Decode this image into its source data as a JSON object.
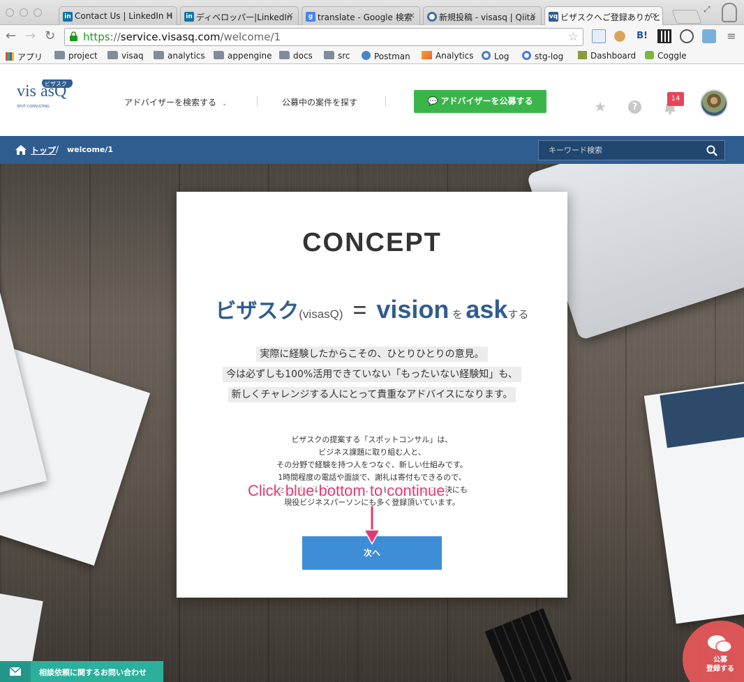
{
  "browser": {
    "tabs": [
      {
        "title": "Contact Us | LinkedIn H",
        "favicon": "linkedin-icon"
      },
      {
        "title": "ディベロッパー|LinkedIn",
        "favicon": "linkedin-icon"
      },
      {
        "title": "translate - Google 検索",
        "favicon": "google-icon"
      },
      {
        "title": "新規投稿 - visasq | Qiita",
        "favicon": "qiita-icon"
      },
      {
        "title": "ビザスクへご登録ありがと",
        "favicon": "visasq-icon"
      }
    ],
    "url": {
      "scheme": "https",
      "sep": "://",
      "host": "service.visasq.com",
      "path": "/welcome/1"
    },
    "bookmarks": [
      {
        "label": "アプリ",
        "icon": "apps-icon"
      },
      {
        "label": "project",
        "icon": "folder-icon"
      },
      {
        "label": "visaq",
        "icon": "folder-icon"
      },
      {
        "label": "analytics",
        "icon": "folder-icon"
      },
      {
        "label": "appengine",
        "icon": "folder-icon"
      },
      {
        "label": "docs",
        "icon": "folder-icon"
      },
      {
        "label": "src",
        "icon": "folder-icon"
      },
      {
        "label": "Postman",
        "icon": "globe-icon"
      },
      {
        "label": "Analytics",
        "icon": "analytics-icon"
      },
      {
        "label": "Log",
        "icon": "log-icon"
      },
      {
        "label": "stg-log",
        "icon": "log-icon"
      },
      {
        "label": "Dashboard",
        "icon": "cube-icon"
      },
      {
        "label": "Coggle",
        "icon": "coggle-icon"
      }
    ]
  },
  "header": {
    "logo": {
      "text": "vis asQ",
      "ruby": "ビザスク",
      "sub": "SPOT CONSULTING"
    },
    "nav": {
      "search_advisors": "アドバイザーを検索する",
      "find_projects": "公募中の案件を探す"
    },
    "cta_label": "アドバイザーを公募する",
    "notification_count": "14"
  },
  "breadcrumb": {
    "home": "トップ",
    "separator": "/",
    "current": "welcome/1"
  },
  "search": {
    "placeholder": "キーワード検索"
  },
  "concept": {
    "heading": "CONCEPT",
    "tagline": {
      "brand": "ビザスク",
      "brand_paren": "(visasQ)",
      "equals": "=",
      "vision": "vision",
      "wo": "を",
      "ask": "ask",
      "suru": "する"
    },
    "lead": [
      "実際に経験したからこその、ひとりひとりの意見。",
      "今は必ずしも100%活用できていない「もったいない経験知」も、",
      "新しくチャレンジする人にとって貴重なアドバイスになります。"
    ],
    "body": [
      "ビザスクの提案する「スポットコンサル」は、",
      "ビジネス課題に取り組む人と、",
      "その分野で経験を持つ人をつなぐ、新しい仕組みです。",
      "1時間程度の電話や面談で、謝礼は寄付もできるので、",
      "企業の課題に経験を生かして、ビジネス課題の解決にも",
      "現役ビジネスパーソンにも多く登録頂いています。"
    ],
    "next_button": "次へ"
  },
  "annotation": "Click blue bottom to continue.",
  "contact_bar": "相談依頼に関するお問い合わせ",
  "fab": {
    "line1": "公募",
    "line2": "登録する"
  },
  "colors": {
    "brand_blue": "#2f5d90",
    "cta_green": "#3ab54a",
    "next_blue": "#3d8ed6",
    "badge_red": "#e8445a",
    "annotation_pink": "#e63775",
    "contact_teal": "#2ab09d"
  }
}
